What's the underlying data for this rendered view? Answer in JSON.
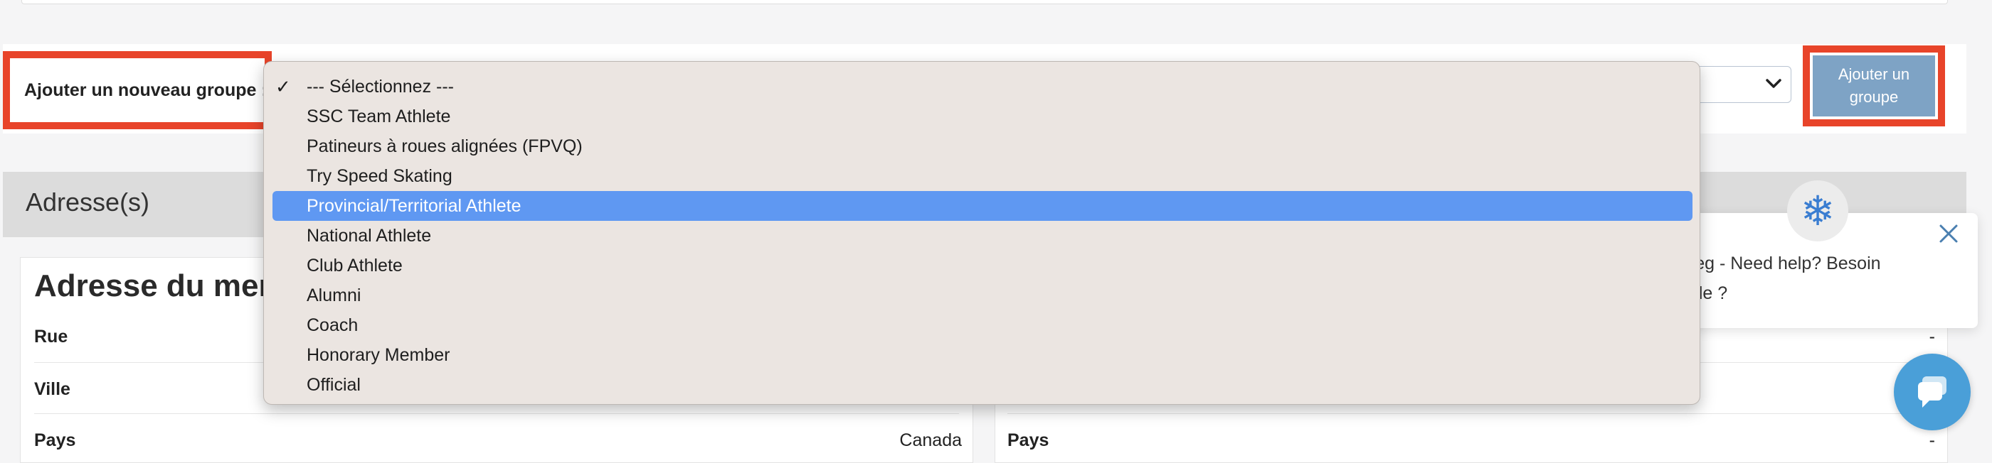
{
  "group_form": {
    "label": "Ajouter un nouveau groupe :",
    "add_button_label": "Ajouter un groupe",
    "dropdown_options": [
      "--- Sélectionnez ---",
      "SSC Team Athlete",
      "Patineurs à roues alignées (FPVQ)",
      "Try Speed Skating",
      "Provincial/Territorial Athlete",
      "National Athlete",
      "Club Athlete",
      "Alumni",
      "Coach",
      "Honorary Member",
      "Official"
    ],
    "checked_option": "--- Sélectionnez ---",
    "highlighted_option": "Provincial/Territorial Athlete"
  },
  "address_section": {
    "title": "Adresse(s)",
    "member_card_title": "Adresse du mer",
    "left_rows": [
      {
        "label": "Rue",
        "value": ""
      },
      {
        "label": "Ville",
        "value": ""
      },
      {
        "label": "Pays",
        "value": "Canada"
      }
    ],
    "right_rows": [
      {
        "label": "",
        "value": "-"
      },
      {
        "label": "",
        "value": ""
      },
      {
        "label": "Pays",
        "value": "-"
      }
    ]
  },
  "help_widget": {
    "text": "ereg - Need help? Besoin aide ?",
    "avatar_icon": "snowflake-icon",
    "close_icon": "close-icon",
    "chat_icon": "chat-bubble-icon"
  },
  "colors": {
    "highlight_border": "#e8442a",
    "button_bg": "#7ea3c5",
    "selected_option_bg": "#5f98f2",
    "dropdown_bg": "#ebe5e1",
    "chat_bg": "#4a9fd8"
  }
}
